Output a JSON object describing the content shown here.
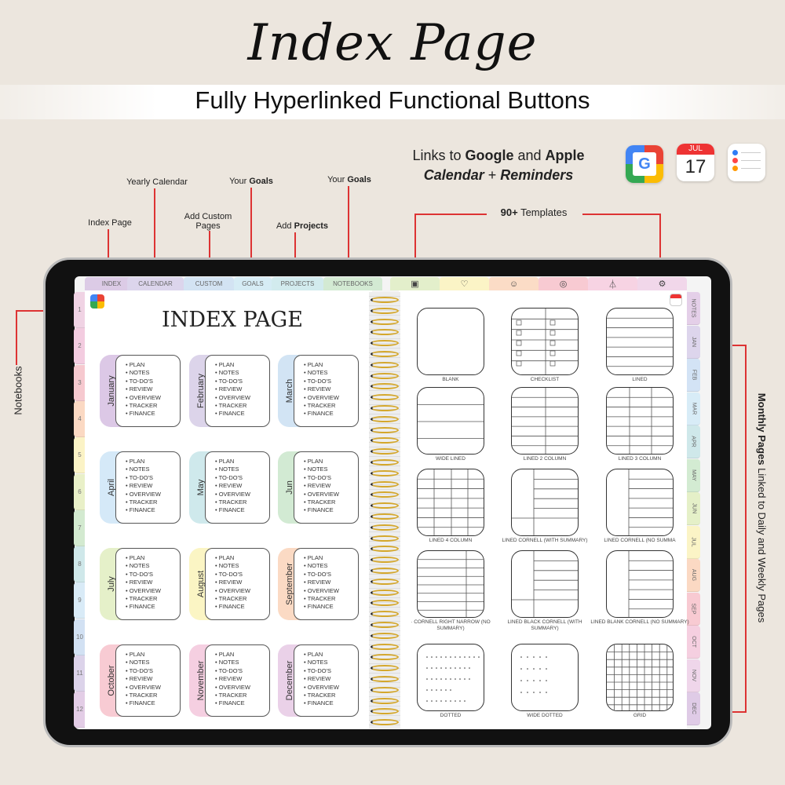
{
  "header": {
    "title": "Index Page",
    "subtitle": "Fully Hyperlinked Functional Buttons"
  },
  "annotations": {
    "index_page": "Index Page",
    "yearly_calendar": "Yearly Calendar",
    "add_custom_pages": "Add Custom Pages",
    "your_goals_1_pre": "Your ",
    "your_goals_1_bold": "Goals",
    "add_projects_pre": "Add ",
    "add_projects_bold": "Projects",
    "your_goals_2_pre": "Your ",
    "your_goals_2_bold": "Goals",
    "templates_bold": "90+",
    "templates_rest": " Templates",
    "notebooks": "Notebooks",
    "monthly_bold": "Monthly Pages",
    "monthly_rest": " Linked to Daily and Weekly Pages",
    "links_pre": "Links to ",
    "links_google": "Google",
    "links_and": " and ",
    "links_apple": "Apple",
    "links_cal": "Calendar",
    "links_plus": " + ",
    "links_rem": "Reminders"
  },
  "apps": {
    "calendar_month": "JUL",
    "calendar_day": "17",
    "google_letter": "G"
  },
  "top_tabs": [
    {
      "label": "INDEX",
      "color": "#dccbe6"
    },
    {
      "label": "CALENDAR",
      "color": "#dcd5ec"
    },
    {
      "label": "CUSTOM",
      "color": "#d3e3f3"
    },
    {
      "label": "GOALS",
      "color": "#d6ecf5"
    },
    {
      "label": "PROJECTS",
      "color": "#d2ebee"
    },
    {
      "label": "NOTEBOOKS",
      "color": "#d3ead3"
    }
  ],
  "icon_tabs": [
    {
      "icon": "template-icon",
      "color": "#e3efcb"
    },
    {
      "icon": "heart-icon",
      "color": "#fbf4c6"
    },
    {
      "icon": "people-icon",
      "color": "#fbdcc6"
    },
    {
      "icon": "compass-icon",
      "color": "#f8cad2"
    },
    {
      "icon": "hanger-icon",
      "color": "#f7d3e3"
    },
    {
      "icon": "settings-icon",
      "color": "#f1d7ea"
    }
  ],
  "number_tabs": [
    {
      "label": "1",
      "color": "#f0d3e4"
    },
    {
      "label": "2",
      "color": "#f3cce0"
    },
    {
      "label": "3",
      "color": "#f6c9cf"
    },
    {
      "label": "4",
      "color": "#fbd9c3"
    },
    {
      "label": "5",
      "color": "#fbf3c6"
    },
    {
      "label": "6",
      "color": "#e9f0c8"
    },
    {
      "label": "7",
      "color": "#d3ead0"
    },
    {
      "label": "8",
      "color": "#cfe8ea"
    },
    {
      "label": "9",
      "color": "#d9ebf7"
    },
    {
      "label": "10",
      "color": "#d2e1f3"
    },
    {
      "label": "11",
      "color": "#dcd3ea"
    },
    {
      "label": "12",
      "color": "#e3cde6"
    }
  ],
  "month_tabs": [
    {
      "label": "NOTES",
      "color": "#e4cfe8"
    },
    {
      "label": "JAN",
      "color": "#ddd5ec"
    },
    {
      "label": "FEB",
      "color": "#d3e3f5"
    },
    {
      "label": "MAR",
      "color": "#d8ecf7"
    },
    {
      "label": "APR",
      "color": "#cfe8ea"
    },
    {
      "label": "MAY",
      "color": "#d3ebd2"
    },
    {
      "label": "JUN",
      "color": "#e5f0c8"
    },
    {
      "label": "JUL",
      "color": "#fbf4c6"
    },
    {
      "label": "AUG",
      "color": "#fbd9c3"
    },
    {
      "label": "SEP",
      "color": "#f8cad2"
    },
    {
      "label": "OCT",
      "color": "#f5cfe0"
    },
    {
      "label": "NOV",
      "color": "#efd6ea"
    },
    {
      "label": "DEC",
      "color": "#dfcbe6"
    }
  ],
  "index_page": {
    "title": "INDEX PAGE",
    "items": [
      "PLAN",
      "NOTES",
      "TO-DO'S",
      "REVIEW",
      "OVERVIEW",
      "TRACKER",
      "FINANCE"
    ],
    "months": [
      {
        "name": "January",
        "color": "#dcc8e6"
      },
      {
        "name": "February",
        "color": "#dcd4ea"
      },
      {
        "name": "March",
        "color": "#d2e4f4"
      },
      {
        "name": "April",
        "color": "#d5e9f8"
      },
      {
        "name": "May",
        "color": "#cfe9ec"
      },
      {
        "name": "Jun",
        "color": "#d2ead3"
      },
      {
        "name": "July",
        "color": "#e5f0c9"
      },
      {
        "name": "August",
        "color": "#fbf5c4"
      },
      {
        "name": "September",
        "color": "#fbdac4"
      },
      {
        "name": "October",
        "color": "#f8cbd3"
      },
      {
        "name": "November",
        "color": "#f5cfe1"
      },
      {
        "name": "December",
        "color": "#ead1e8"
      }
    ]
  },
  "templates": [
    {
      "label": "BLANK",
      "type": "blank"
    },
    {
      "label": "CHECKLIST",
      "type": "checklist"
    },
    {
      "label": "LINED",
      "type": "lined"
    },
    {
      "label": "WIDE LINED",
      "type": "wide"
    },
    {
      "label": "LINED 2 COLUMN",
      "type": "col2"
    },
    {
      "label": "LINED 3 COLUMN",
      "type": "col3"
    },
    {
      "label": "LINED 4 COLUMN",
      "type": "col4"
    },
    {
      "label": "LINED CORNELL (WITH SUMMARY)",
      "type": "cornell_sum"
    },
    {
      "label": "LINED CORNELL (NO SUMMA",
      "type": "cornell"
    },
    {
      "label": "· CORNELL RIGHT NARROW (NO SUMMARY)",
      "type": "right_narrow"
    },
    {
      "label": "LINED BLACK CORNELL (WITH SUMMARY)",
      "type": "black_cornell"
    },
    {
      "label": "LINED BLANK CORNELL (NO SUMMARY)",
      "type": "blank_cornell"
    },
    {
      "label": "DOTTED",
      "type": "dotted"
    },
    {
      "label": "WIDE DOTTED",
      "type": "wide_dotted"
    },
    {
      "label": "GRID",
      "type": "grid"
    }
  ]
}
